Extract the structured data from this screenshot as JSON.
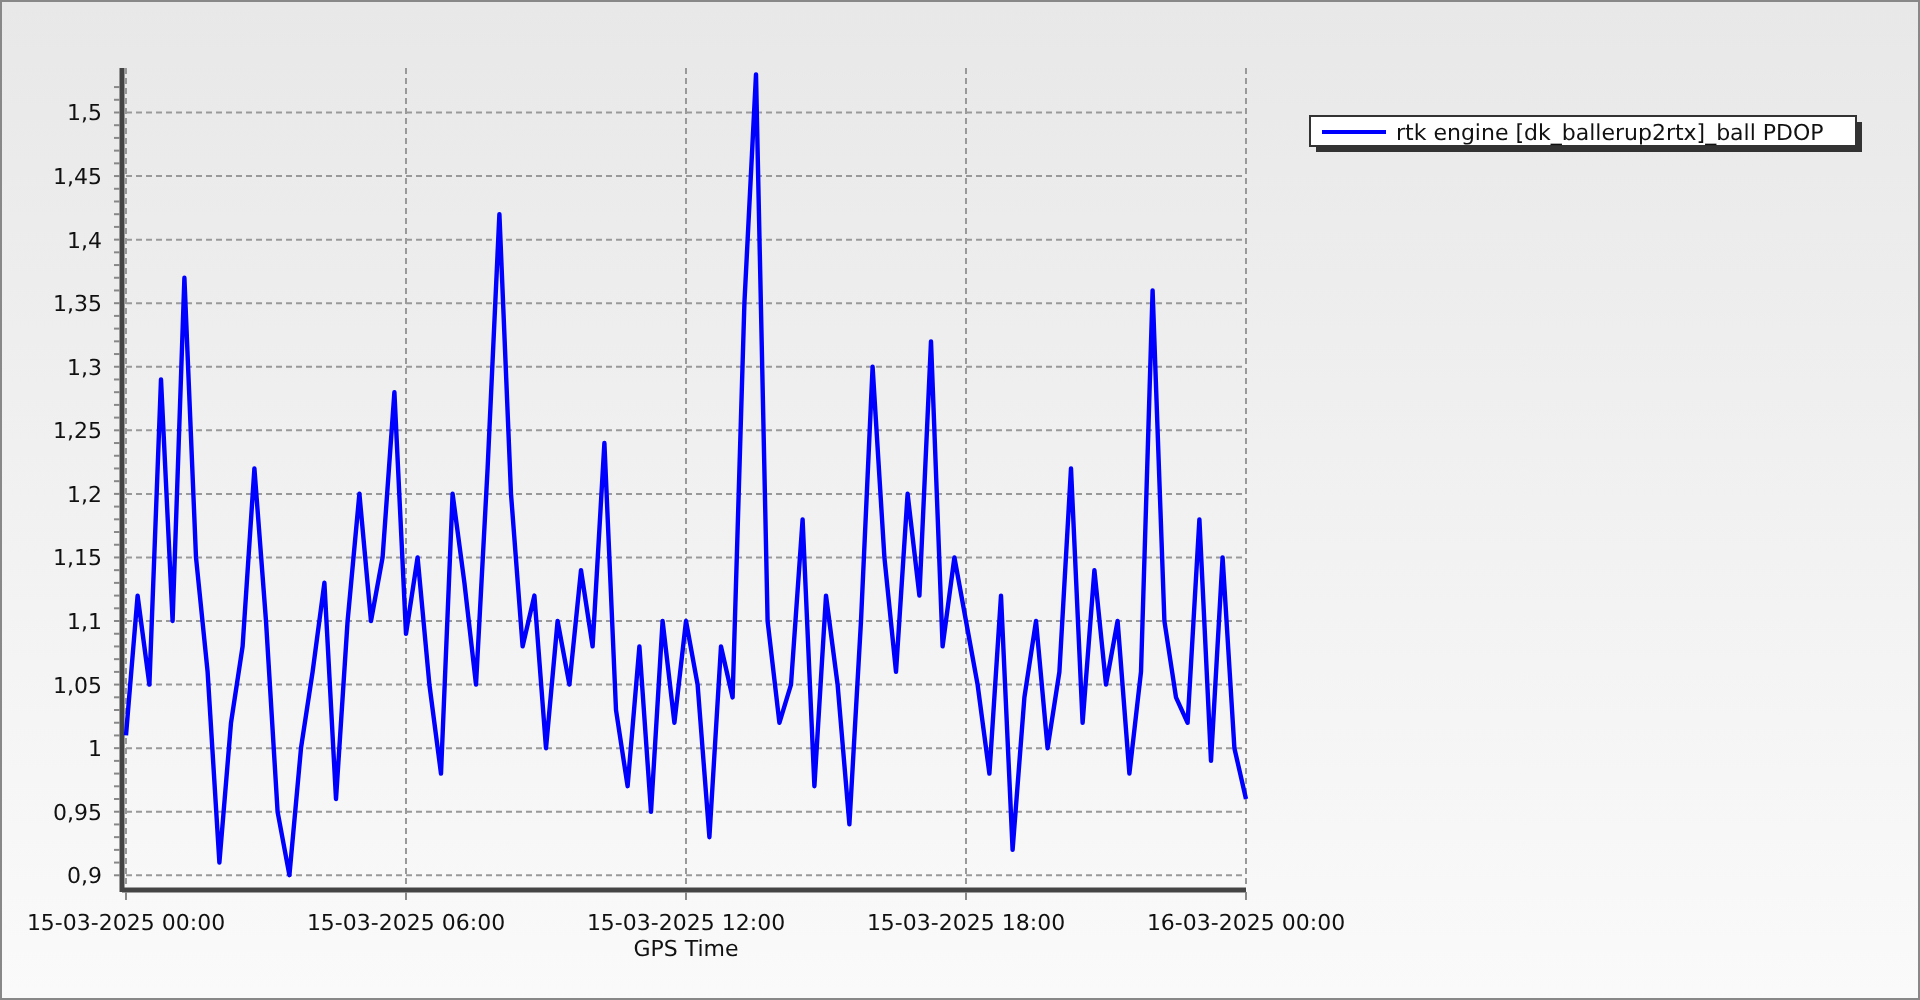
{
  "chart_data": {
    "type": "line",
    "grid": true,
    "xlabel": "GPS Time",
    "ylim": [
      0.89,
      1.535
    ],
    "categories": [
      "15-03-2025 00:00",
      null,
      null,
      null,
      null,
      null,
      null,
      null,
      null,
      null,
      null,
      null,
      null,
      null,
      null,
      null,
      null,
      null,
      null,
      null,
      null,
      null,
      null,
      null,
      "15-03-2025 06:00",
      null,
      null,
      null,
      null,
      null,
      null,
      null,
      null,
      null,
      null,
      null,
      null,
      null,
      null,
      null,
      null,
      null,
      null,
      null,
      null,
      null,
      null,
      null,
      "15-03-2025 12:00",
      null,
      null,
      null,
      null,
      null,
      null,
      null,
      null,
      null,
      null,
      null,
      null,
      null,
      null,
      null,
      null,
      null,
      null,
      null,
      null,
      null,
      null,
      null,
      "15-03-2025 18:00",
      null,
      null,
      null,
      null,
      null,
      null,
      null,
      null,
      null,
      null,
      null,
      null,
      null,
      null,
      null,
      null,
      null,
      null,
      null,
      null,
      null,
      null,
      null,
      "16-03-2025 00:00"
    ],
    "yticks": [
      {
        "value": 0.9,
        "label": "0,9"
      },
      {
        "value": 0.95,
        "label": "0,95"
      },
      {
        "value": 1,
        "label": "1"
      },
      {
        "value": 1.05,
        "label": "1,05"
      },
      {
        "value": 1.1,
        "label": "1,1"
      },
      {
        "value": 1.15,
        "label": "1,15"
      },
      {
        "value": 1.2,
        "label": "1,2"
      },
      {
        "value": 1.25,
        "label": "1,25"
      },
      {
        "value": 1.3,
        "label": "1,3"
      },
      {
        "value": 1.35,
        "label": "1,35"
      },
      {
        "value": 1.4,
        "label": "1,4"
      },
      {
        "value": 1.45,
        "label": "1,45"
      },
      {
        "value": 1.5,
        "label": "1,5"
      }
    ],
    "series": [
      {
        "name": "rtk engine [dk_ballerup2rtx]_ball PDOP",
        "color": "#0000ff",
        "values": [
          1.01,
          1.12,
          1.05,
          1.29,
          1.1,
          1.37,
          1.15,
          1.06,
          0.91,
          1.02,
          1.08,
          1.22,
          1.1,
          0.95,
          0.9,
          1.0,
          1.06,
          1.13,
          0.96,
          1.1,
          1.2,
          1.1,
          1.15,
          1.28,
          1.09,
          1.15,
          1.05,
          0.98,
          1.2,
          1.13,
          1.05,
          1.22,
          1.42,
          1.2,
          1.08,
          1.12,
          1.0,
          1.1,
          1.05,
          1.14,
          1.08,
          1.24,
          1.03,
          0.97,
          1.08,
          0.95,
          1.1,
          1.02,
          1.1,
          1.05,
          0.93,
          1.08,
          1.04,
          1.35,
          1.53,
          1.1,
          1.02,
          1.05,
          1.18,
          0.97,
          1.12,
          1.05,
          0.94,
          1.1,
          1.3,
          1.15,
          1.06,
          1.2,
          1.12,
          1.32,
          1.08,
          1.15,
          1.1,
          1.05,
          0.98,
          1.12,
          0.92,
          1.04,
          1.1,
          1.0,
          1.06,
          1.22,
          1.02,
          1.14,
          1.05,
          1.1,
          0.98,
          1.06,
          1.36,
          1.1,
          1.04,
          1.02,
          1.18,
          0.99,
          1.15,
          1.0,
          0.96
        ]
      }
    ]
  }
}
